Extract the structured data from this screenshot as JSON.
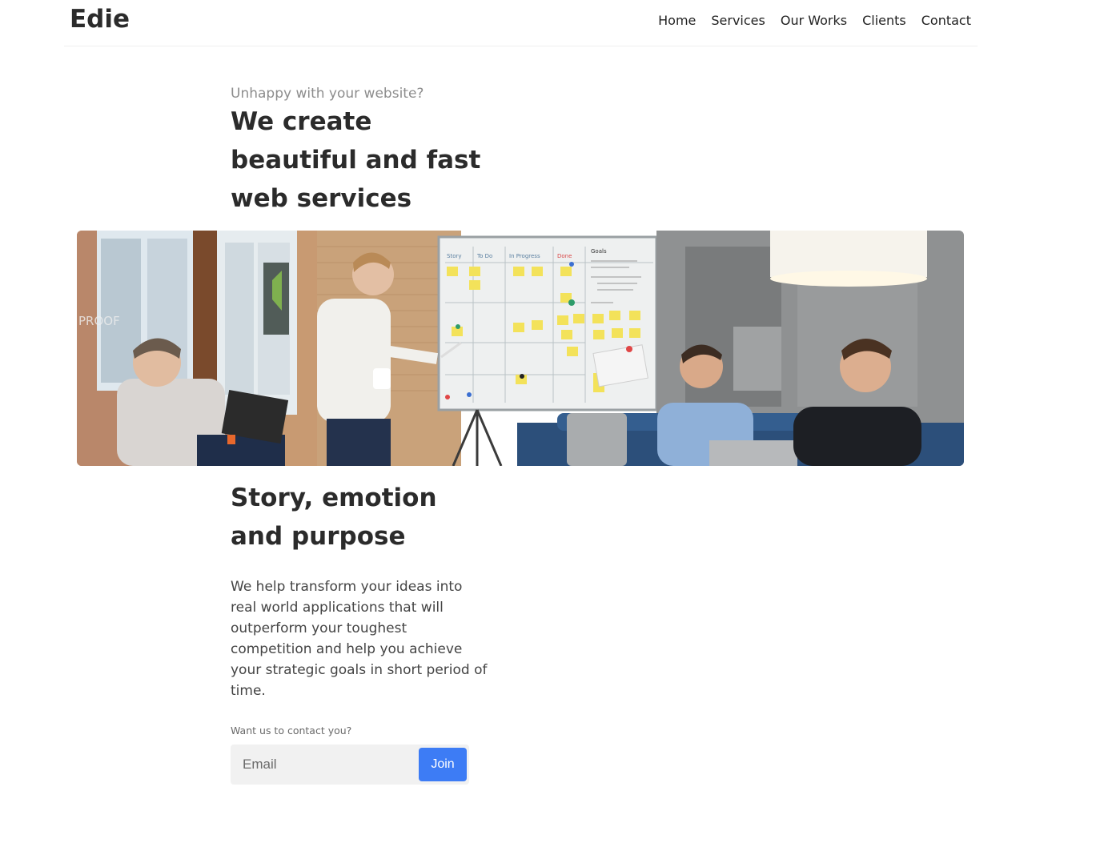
{
  "header": {
    "logo": "Edie",
    "nav": [
      "Home",
      "Services",
      "Our Works",
      "Clients",
      "Contact"
    ]
  },
  "hero": {
    "eyebrow": "Unhappy with your website?",
    "title_lines": [
      "We create",
      "beautiful and fast",
      "web services"
    ]
  },
  "story": {
    "title_lines": [
      "Story, emotion",
      "and purpose"
    ],
    "body": "We help transform your ideas into real world applications that will outperform your toughest competition and help you achieve your strategic goals in short period of time."
  },
  "signup": {
    "label": "Want us to contact you?",
    "email_placeholder": "Email",
    "button_label": "Join",
    "button_color": "#3d7cf5"
  },
  "hero_image": {
    "board_headers": [
      "Story",
      "To Do",
      "In Progress",
      "Done",
      "Goals"
    ],
    "wall_sign": "PROOF"
  }
}
